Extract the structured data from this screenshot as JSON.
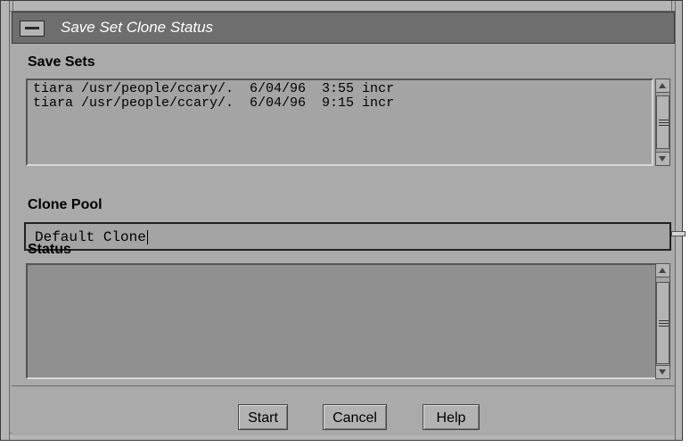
{
  "window": {
    "title": "Save Set Clone Status"
  },
  "save_sets": {
    "label": "Save Sets",
    "rows": [
      "tiara /usr/people/ccary/.  6/04/96  3:55 incr",
      "tiara /usr/people/ccary/.  6/04/96  9:15 incr"
    ]
  },
  "clone_pool": {
    "label": "Clone Pool",
    "value": "Default Clone"
  },
  "status": {
    "label": "Status",
    "text": ""
  },
  "buttons": {
    "start": "Start",
    "cancel": "Cancel",
    "help": "Help"
  },
  "icons": [
    "window-menu-icon",
    "scroll-up-arrow-icon",
    "scroll-down-arrow-icon"
  ],
  "colors": {
    "background": "#aaaaaa",
    "titlebar": "#6e6e6e",
    "title_text": "#ffffff"
  }
}
